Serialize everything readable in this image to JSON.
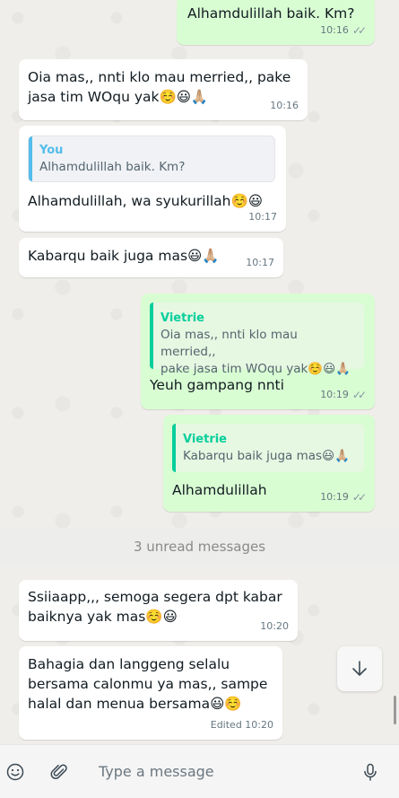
{
  "messages": [
    {
      "text": "Alhamdulillah baik. Km?",
      "time": "10:16"
    },
    {
      "text": "Oia mas,, nnti klo mau merried,, pake\njasa tim WOqu yak☺️😃🙏🏼",
      "time": "10:16"
    },
    {
      "quote_author": "You",
      "quote_text": "Alhamdulillah baik. Km?",
      "text": "Alhamdulillah, wa syukurillah☺️😃",
      "time": "10:17"
    },
    {
      "text": "Kabarqu baik juga mas😃🙏🏼",
      "time": "10:17"
    },
    {
      "quote_author": "Vietrie",
      "quote_text": "Oia mas,, nnti klo mau merried,,\npake jasa tim WOqu yak☺️😃🙏🏼",
      "text": "Yeuh gampang nnti",
      "time": "10:19"
    },
    {
      "quote_author": "Vietrie",
      "quote_text": "Kabarqu baik juga mas😃🙏🏼",
      "text": "Alhamdulillah",
      "time": "10:19"
    },
    {
      "text": "Ssiiaapp,,, semoga segera dpt kabar\nbaiknya yak mas☺️😃",
      "time": "10:20"
    },
    {
      "text": "Bahagia dan langgeng selalu\nbersama calonmu ya mas,, sampe\nhalal dan menua bersama😃☺️",
      "time": "Edited 10:20"
    }
  ],
  "unread_divider": "3 unread messages",
  "composer": {
    "placeholder": "Type a message"
  },
  "icons": {
    "emoji": "emoji-icon",
    "attach": "paperclip-icon",
    "mic": "microphone-icon",
    "scroll_down": "arrow-down-icon",
    "read_receipt": "double-check-icon"
  },
  "colors": {
    "incoming": "#ffffff",
    "outgoing": "#d9fdd3",
    "quote_you": "#53bdeb",
    "quote_other": "#06cf9c"
  }
}
